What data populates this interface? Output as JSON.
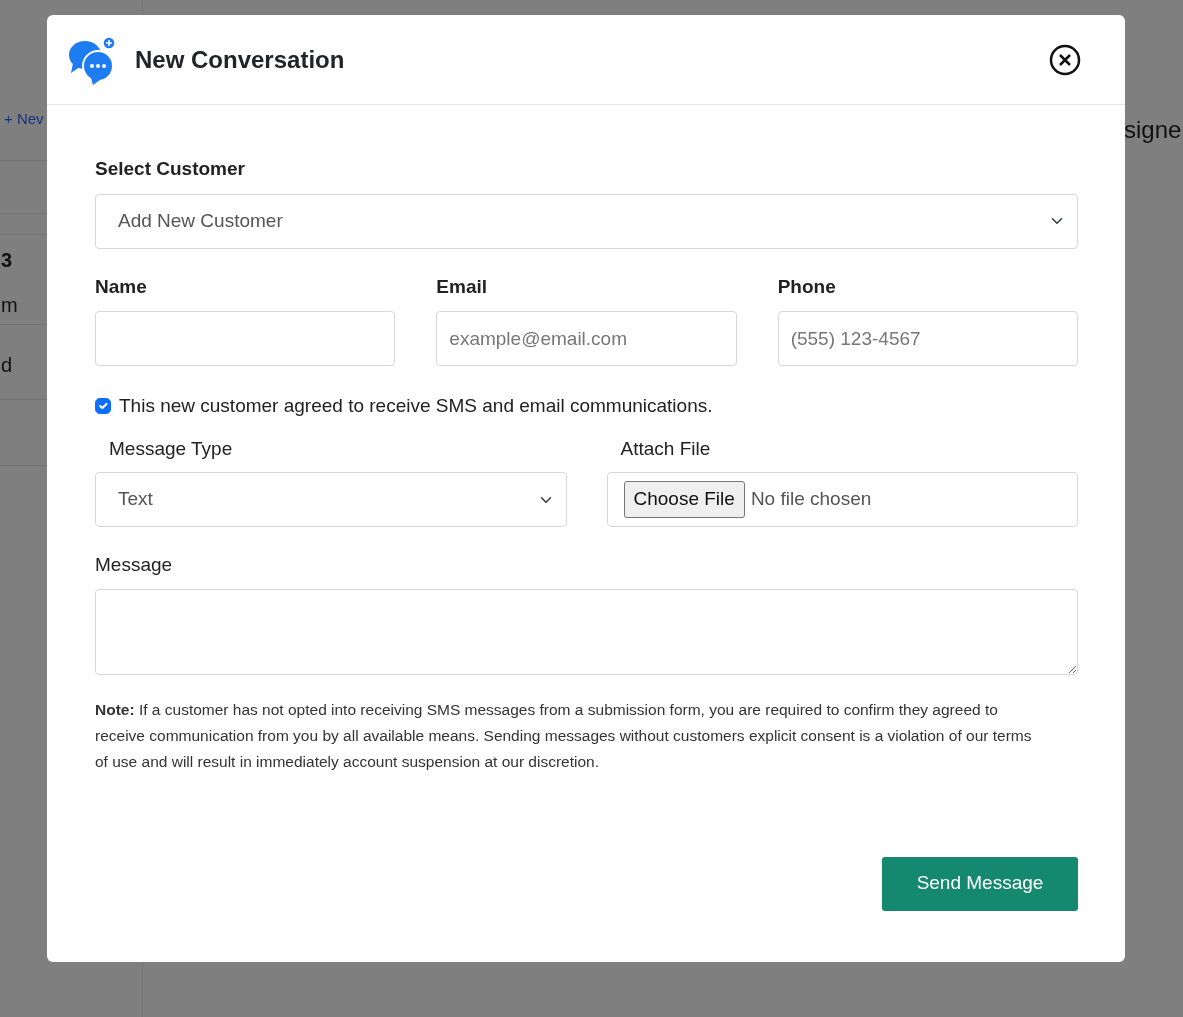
{
  "background": {
    "new_link": "+ Nev",
    "labels": [
      "3",
      "m",
      "d"
    ],
    "header_text": "signe"
  },
  "dialog": {
    "title": "New Conversation",
    "customer": {
      "label": "Select Customer",
      "value": "Add New Customer"
    },
    "fields": [
      {
        "label": "Name"
      },
      {
        "label": "Email",
        "placeholder": "example@email.com"
      },
      {
        "label": "Phone",
        "placeholder": "(555) 123-4567"
      }
    ],
    "consent": {
      "checked": true,
      "text": "This new customer agreed to receive SMS and email communications."
    },
    "message_type": {
      "label": "Message Type",
      "value": "Text"
    },
    "attach": {
      "label": "Attach File",
      "button": "Choose File",
      "status": "No file chosen"
    },
    "message": {
      "label": "Message"
    },
    "note": "**Note:** If a customer has not opted into receiving SMS messages from a submission form, you are required to confirm they agreed to receive communication from you by all available means. Sending messages without customers explicit consent is a violation of our terms of use and will result in immediately account suspension at our discretion.",
    "send_button": "Send Message"
  }
}
